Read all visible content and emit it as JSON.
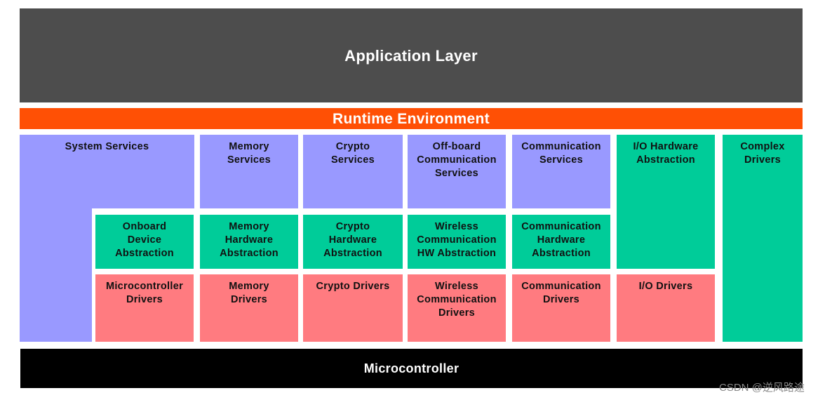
{
  "colors": {
    "application": "#4d4d4d",
    "runtime": "#ff5005",
    "services": "#9999ff",
    "hardware_abstraction": "#00cc99",
    "drivers": "#ff7b80",
    "microcontroller": "#000000"
  },
  "application_layer": "Application Layer",
  "runtime_environment": "Runtime Environment",
  "microcontroller": "Microcontroller",
  "system_services": "System Services",
  "services": [
    "Memory\nServices",
    "Crypto\nServices",
    "Off-board\nCommunication\nServices",
    "Communication\nServices"
  ],
  "io_hw_abstraction": "I/O Hardware\nAbstraction",
  "complex_drivers": "Complex\nDrivers",
  "hw_abstraction": [
    "Onboard\nDevice\nAbstraction",
    "Memory\nHardware\nAbstraction",
    "Crypto\nHardware\nAbstraction",
    "Wireless\nCommunication\nHW Abstraction",
    "Communication\nHardware\nAbstraction"
  ],
  "drivers": [
    "Microcontroller\nDrivers",
    "Memory\nDrivers",
    "Crypto Drivers",
    "Wireless\nCommunication\nDrivers",
    "Communication\nDrivers",
    "I/O Drivers"
  ],
  "watermark": "CSDN @逆风路途"
}
